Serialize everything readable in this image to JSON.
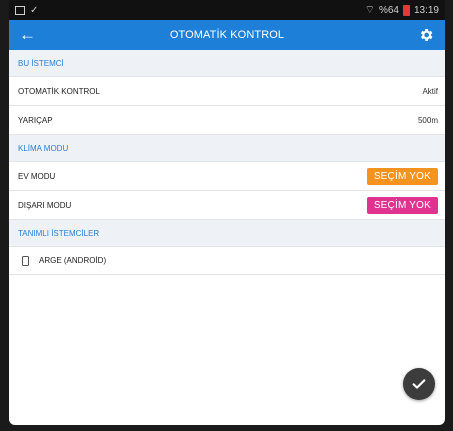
{
  "status_bar": {
    "signal": "%64",
    "time": "13:19"
  },
  "app_bar": {
    "title": "OTOMATİK KONTROL",
    "back_icon": "arrow-left-icon",
    "settings_icon": "gear-icon"
  },
  "sections": {
    "client": {
      "header": "BU İSTEMCİ",
      "auto_control": {
        "label": "OTOMATİK KONTROL",
        "value": "Aktif"
      },
      "radius": {
        "label": "YARIÇAP",
        "value": "500m"
      }
    },
    "ac_mode": {
      "header": "KLİMA MODU",
      "home_mode": {
        "label": "EV MODU",
        "button": "SEÇİM YOK"
      },
      "away_mode": {
        "label": "DIŞARI MODU",
        "button": "SEÇİM YOK"
      }
    },
    "clients": {
      "header": "TANIMLI İSTEMCİLER",
      "items": [
        {
          "name": "ARGE (ANDROİD)"
        }
      ]
    }
  },
  "colors": {
    "primary": "#1e7fd9",
    "home_button": "#f6931e",
    "away_button": "#e0338f",
    "fab": "#3c3c3c"
  }
}
